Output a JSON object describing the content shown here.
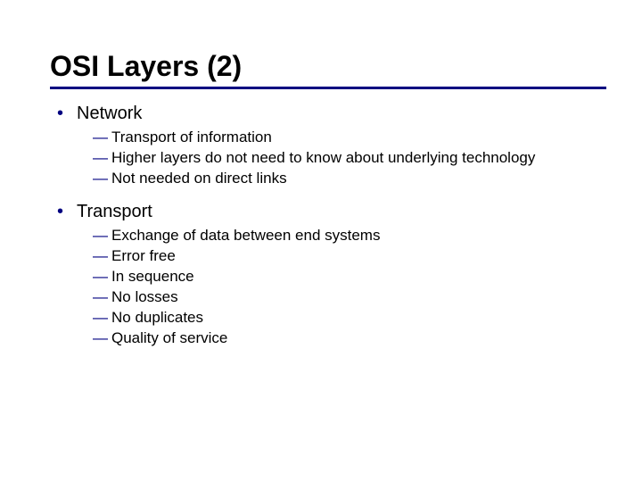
{
  "title": "OSI Layers (2)",
  "sections": [
    {
      "heading": "Network",
      "items": [
        "Transport of information",
        "Higher layers do not need to know about underlying technology",
        "Not needed on direct links"
      ]
    },
    {
      "heading": "Transport",
      "items": [
        "Exchange of data between end systems",
        "Error free",
        "In sequence",
        "No losses",
        "No duplicates",
        "Quality of service"
      ]
    }
  ]
}
